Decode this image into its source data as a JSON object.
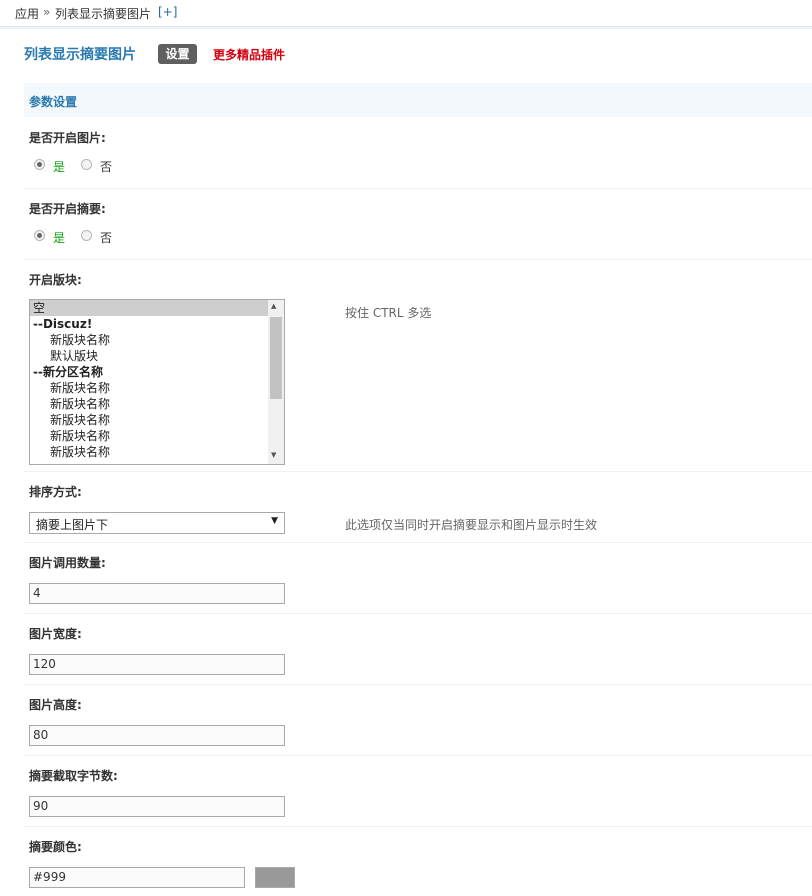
{
  "breadcrumb": {
    "root": "应用",
    "sep": "»",
    "current": "列表显示摘要图片",
    "add": "[+]"
  },
  "header": {
    "title": "列表显示摘要图片",
    "settings_label": "设置",
    "more_label": "更多精品插件"
  },
  "section": {
    "title": "参数设置"
  },
  "fields": {
    "enable_image": {
      "label": "是否开启图片:",
      "yes": "是",
      "no": "否",
      "value": "是"
    },
    "enable_summary": {
      "label": "是否开启摘要:",
      "yes": "是",
      "no": "否",
      "value": "是"
    },
    "forums": {
      "label": "开启版块:",
      "hint": "按住 CTRL 多选",
      "options": [
        {
          "text": "空",
          "kind": "selected"
        },
        {
          "text": "--Discuz!",
          "kind": "group"
        },
        {
          "text": "新版块名称",
          "kind": "item"
        },
        {
          "text": "默认版块",
          "kind": "item"
        },
        {
          "text": "--新分区名称",
          "kind": "group"
        },
        {
          "text": "新版块名称",
          "kind": "item"
        },
        {
          "text": "新版块名称",
          "kind": "item"
        },
        {
          "text": "新版块名称",
          "kind": "item"
        },
        {
          "text": "新版块名称",
          "kind": "item"
        },
        {
          "text": "新版块名称",
          "kind": "item"
        }
      ]
    },
    "sort": {
      "label": "排序方式:",
      "value": "摘要上图片下",
      "hint": "此选项仅当同时开启摘要显示和图片显示时生效"
    },
    "image_count": {
      "label": "图片调用数量:",
      "value": "4"
    },
    "image_width": {
      "label": "图片宽度:",
      "value": "120"
    },
    "image_height": {
      "label": "图片高度:",
      "value": "80"
    },
    "summary_bytes": {
      "label": "摘要截取字节数:",
      "value": "90"
    },
    "summary_color": {
      "label": "摘要颜色:",
      "value": "#999",
      "swatch": "#999999"
    }
  },
  "colors": {
    "title": "#2a7ab0",
    "more_link": "#d4000c",
    "yes_text": "#12a012"
  }
}
